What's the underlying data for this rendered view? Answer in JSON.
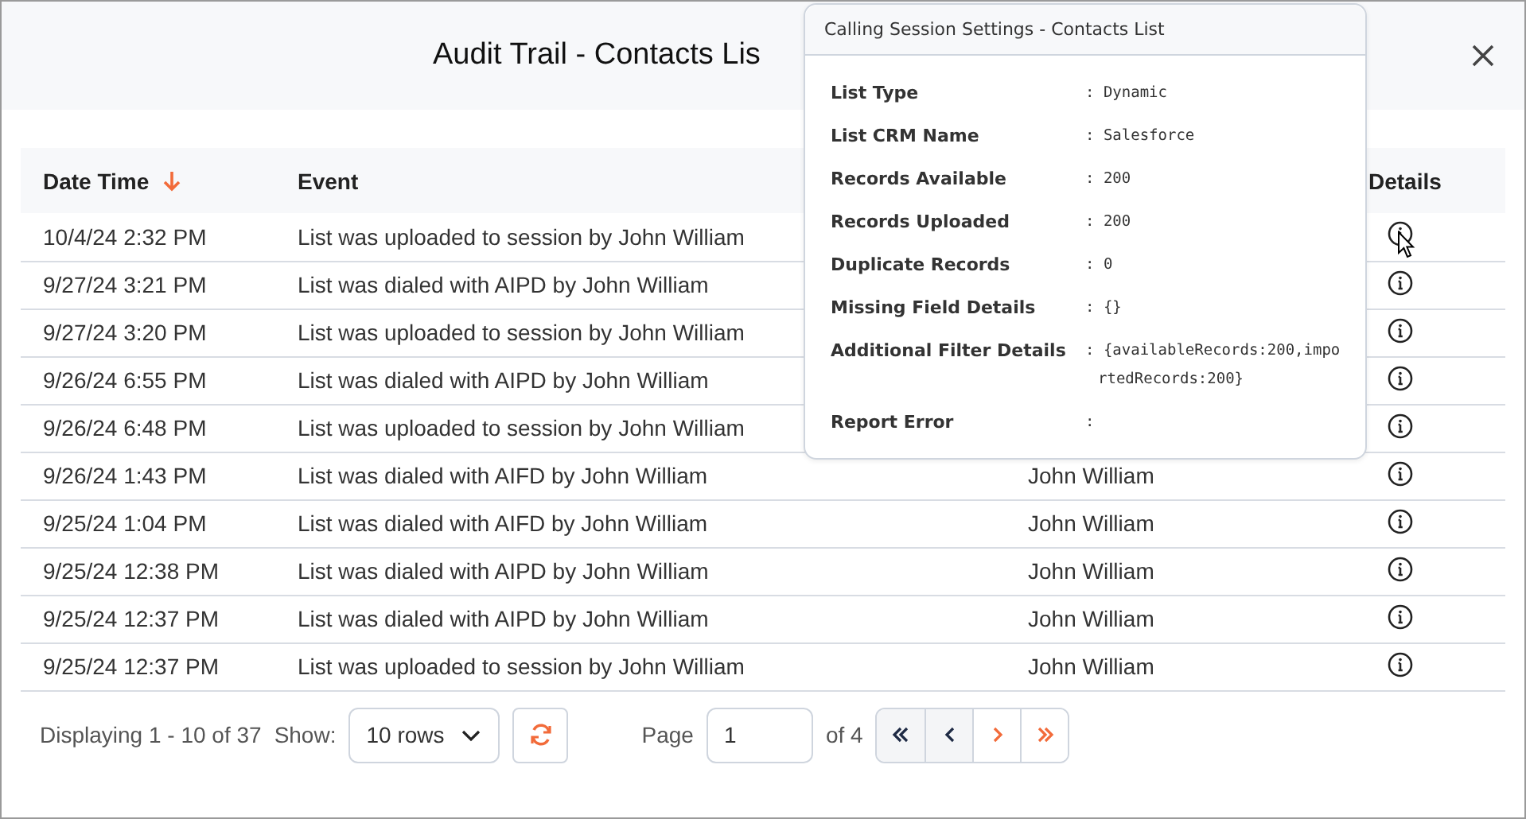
{
  "dialog": {
    "title": "Audit Trail - Contacts Lis"
  },
  "table": {
    "columns": [
      {
        "label": "Date Time",
        "sorted": true
      },
      {
        "label": "Event",
        "sorted": false
      },
      {
        "label": "Details",
        "sorted": false
      }
    ],
    "rows": [
      {
        "date_time": "10/4/24 2:32 PM",
        "event": "List was uploaded to session by John William",
        "hovered": true
      },
      {
        "date_time": "9/27/24 3:21 PM",
        "event": "List was dialed with AIPD by John William",
        "hovered": false
      },
      {
        "date_time": "9/27/24 3:20 PM",
        "event": "List was uploaded to session by John William",
        "hovered": false
      },
      {
        "date_time": "9/26/24 6:55 PM",
        "event": "List was dialed with AIPD by John William",
        "hovered": false
      },
      {
        "date_time": "9/26/24 6:48 PM",
        "event": "List was uploaded to session by John William",
        "hovered": false
      },
      {
        "date_time": "9/26/24 1:43 PM",
        "event": "List was dialed with AIFD by John William",
        "column_3": "John William",
        "hovered": false
      },
      {
        "date_time": "9/25/24 1:04 PM",
        "event": "List was dialed with AIFD by John William",
        "column_3": "John William",
        "hovered": false
      },
      {
        "date_time": "9/25/24 12:38 PM",
        "event": "List was dialed with AIPD by John William",
        "column_3": "John William",
        "hovered": false
      },
      {
        "date_time": "9/25/24 12:37 PM",
        "event": "List was dialed with AIPD by John William",
        "column_3": "John William",
        "hovered": false
      },
      {
        "date_time": "9/25/24 12:37 PM",
        "event": "List was uploaded to session by John William",
        "column_3": "John William",
        "hovered": false
      }
    ]
  },
  "footer": {
    "displaying": "Displaying 1 - 10 of 37",
    "show_label": "Show:",
    "rows_select": "10 rows",
    "page_label": "Page",
    "page_value": "1",
    "of_pages": "of 4",
    "nav": [
      {
        "kind": "first",
        "disabled": true
      },
      {
        "kind": "prev",
        "disabled": true
      },
      {
        "kind": "next",
        "disabled": false
      },
      {
        "kind": "last",
        "disabled": false
      }
    ]
  },
  "popover": {
    "title": "Calling Session Settings - Contacts List",
    "fields": [
      {
        "label": "List Type",
        "value": ": Dynamic"
      },
      {
        "label": "List CRM Name",
        "value": ": Salesforce"
      },
      {
        "label": "Records Available",
        "value": ": 200"
      },
      {
        "label": "Records Uploaded",
        "value": ": 200"
      },
      {
        "label": "Duplicate Records",
        "value": ": 0"
      },
      {
        "label": "Missing Field Details",
        "value": ": {}"
      },
      {
        "label": "Additional Filter Details",
        "value": ": {availableRecords:200,importedRecords:200}"
      },
      {
        "label": "Report Error",
        "value": ":"
      }
    ]
  }
}
